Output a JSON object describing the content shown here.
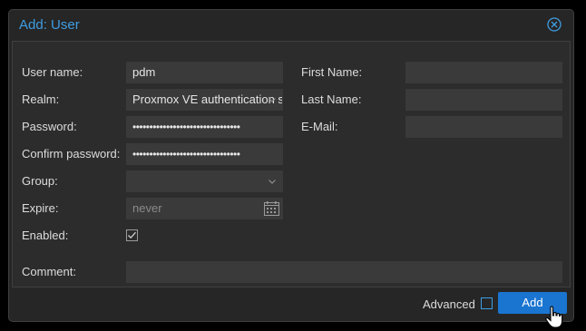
{
  "dialog": {
    "title": "Add: User",
    "close_icon": "close-circle-icon"
  },
  "form": {
    "username_label": "User name:",
    "username_value": "pdm",
    "realm_label": "Realm:",
    "realm_value": "Proxmox VE authentication server",
    "password_label": "Password:",
    "password_value": "••••••••••••••••••••••••••••••••",
    "confirm_password_label": "Confirm password:",
    "confirm_password_value": "••••••••••••••••••••••••••••••••",
    "group_label": "Group:",
    "group_value": "",
    "expire_label": "Expire:",
    "expire_placeholder": "never",
    "enabled_label": "Enabled:",
    "enabled_checked": true,
    "first_name_label": "First Name:",
    "first_name_value": "",
    "last_name_label": "Last Name:",
    "last_name_value": "",
    "email_label": "E-Mail:",
    "email_value": "",
    "comment_label": "Comment:",
    "comment_value": ""
  },
  "footer": {
    "advanced_label": "Advanced",
    "advanced_checked": false,
    "add_label": "Add"
  },
  "colors": {
    "accent": "#3f9de2",
    "button": "#1a75d1",
    "dialog_bg": "#262626",
    "field_bg": "#3a3a3a"
  }
}
